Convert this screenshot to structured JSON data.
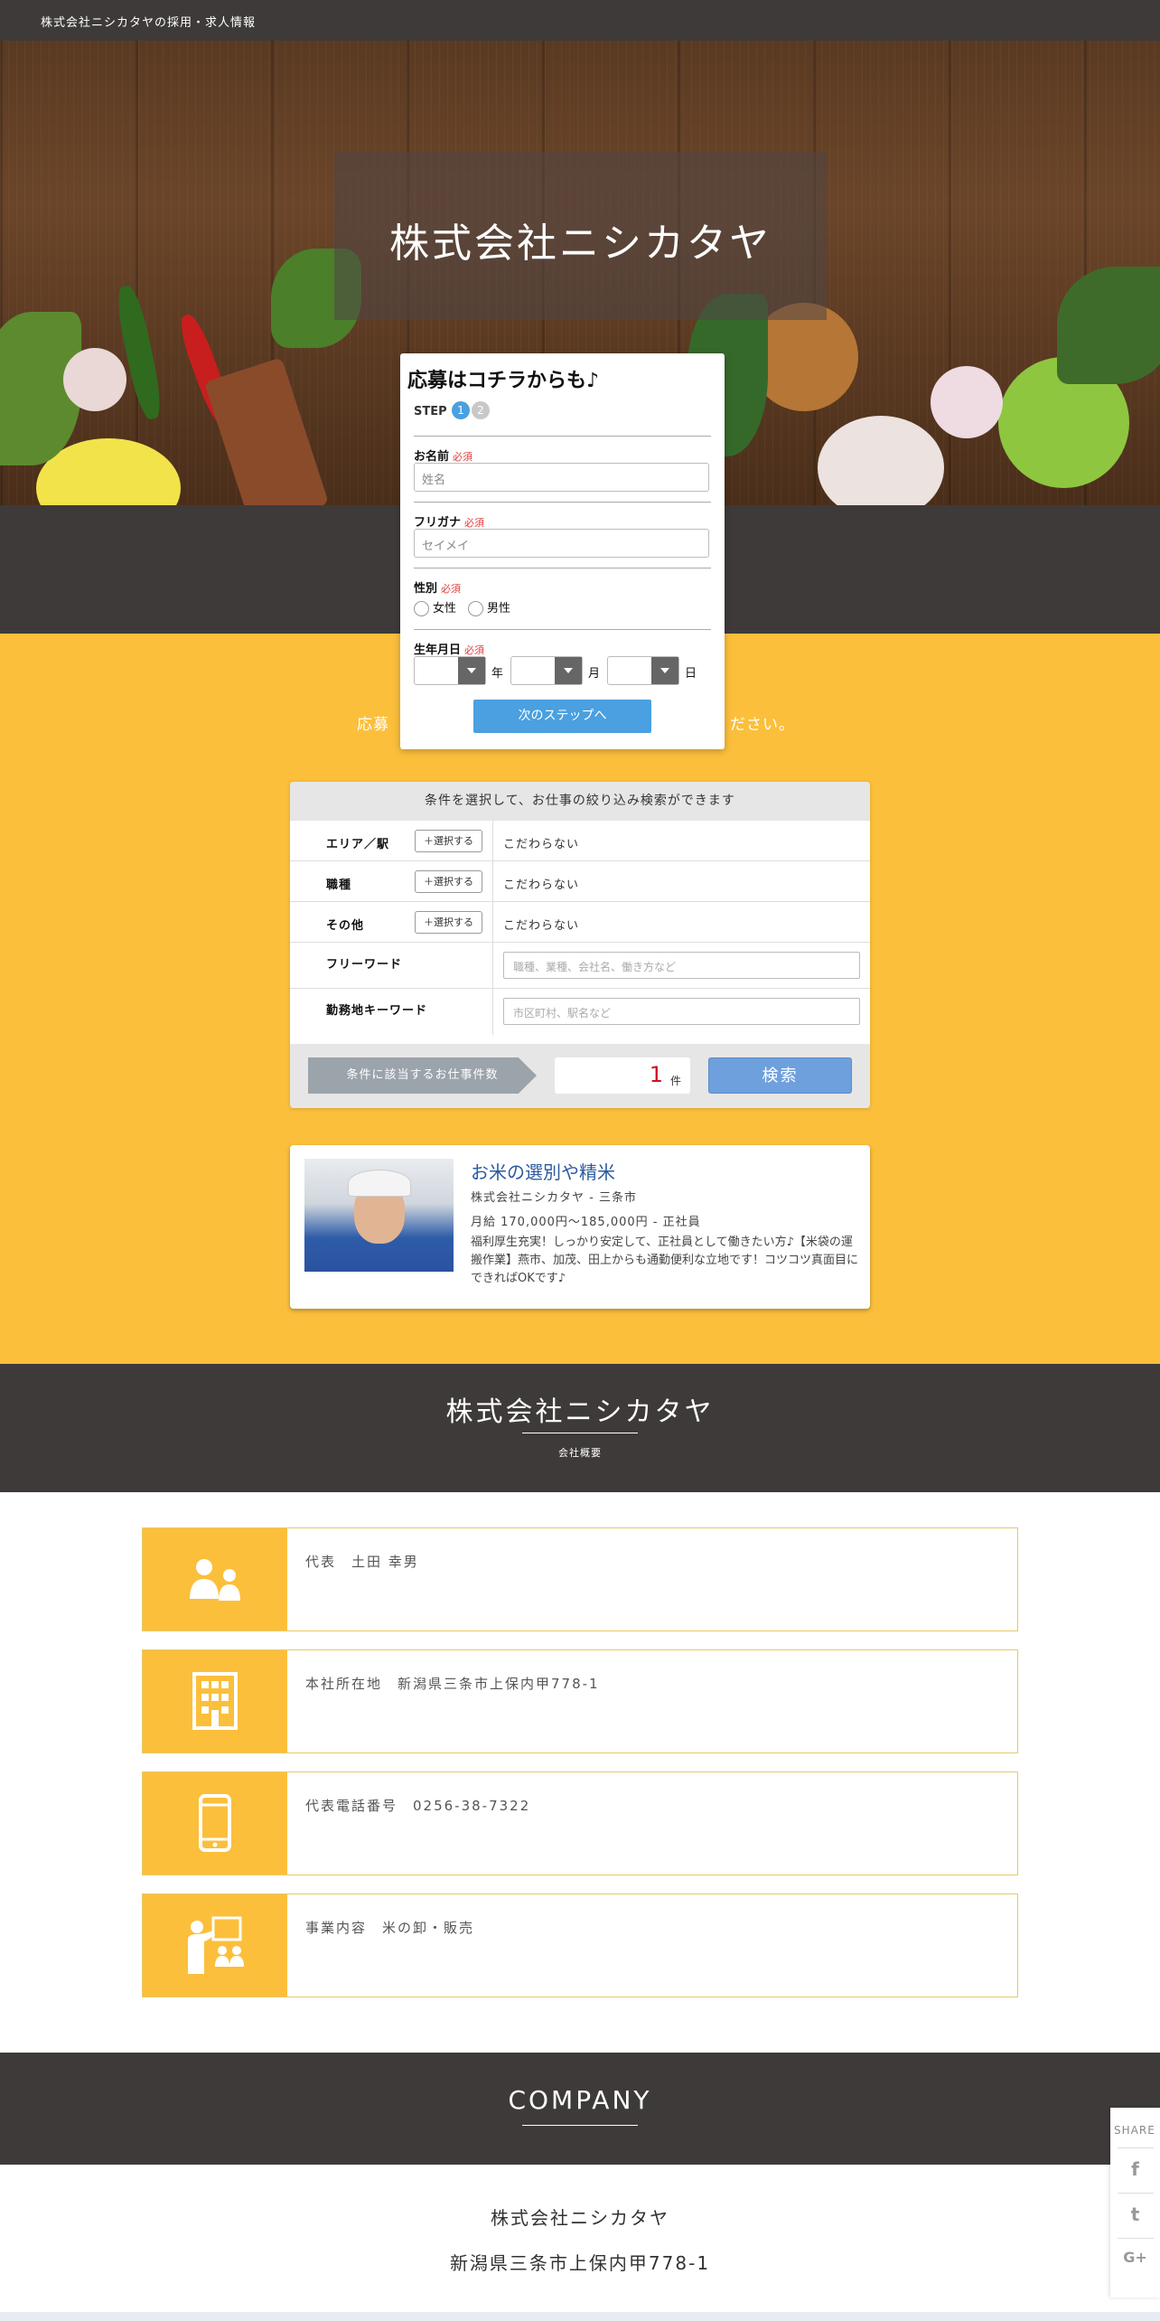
{
  "topbar": {
    "title": "株式会社ニシカタヤの採用・求人情報"
  },
  "hero": {
    "title": "株式会社ニシカタヤ"
  },
  "intro": {
    "line1": "応募",
    "line2": "ださい。"
  },
  "form": {
    "heading": "応募はコチラからも♪",
    "step_label": "STEP",
    "step1": "1",
    "step2": "2",
    "required": "必須",
    "name_label": "お名前",
    "name_placeholder": "姓名",
    "kana_label": "フリガナ",
    "kana_placeholder": "セイメイ",
    "gender_label": "性別",
    "gender_female": "女性",
    "gender_male": "男性",
    "birth_label": "生年月日",
    "year_unit": "年",
    "month_unit": "月",
    "day_unit": "日",
    "next_button": "次のステップへ"
  },
  "search": {
    "header": "条件を選択して、お仕事の絞り込み検索ができます",
    "select_label": "選択する",
    "rows": [
      {
        "label": "エリア／駅",
        "value": "こだわらない"
      },
      {
        "label": "職種",
        "value": "こだわらない"
      },
      {
        "label": "その他",
        "value": "こだわらない"
      }
    ],
    "freeword_label": "フリーワード",
    "freeword_placeholder": "職種、業種、会社名、働き方など",
    "area_keyword_label": "勤務地キーワード",
    "area_keyword_placeholder": "市区町村、駅名など",
    "count_label": "条件に該当するお仕事件数",
    "count": "1",
    "count_unit": "件",
    "search_button": "検索"
  },
  "job": {
    "title": "お米の選別や精米",
    "company": "株式会社ニシカタヤ - 三条市",
    "salary": "月給 170,000円～185,000円 - 正社員",
    "description": "福利厚生充実！しっかり安定して、正社員として働きたい方♪【米袋の運搬作業】燕市、加茂、田上からも通勤便利な立地です！コツコツ真面目にできればOKです♪"
  },
  "company_band": {
    "title": "株式会社ニシカタヤ",
    "subtitle": "会社概要"
  },
  "info": [
    {
      "icon": "people-icon",
      "text": "代表　土田 幸男"
    },
    {
      "icon": "building-icon",
      "text": "本社所在地　新潟県三条市上保内甲778-1"
    },
    {
      "icon": "smartphone-icon",
      "text": "代表電話番号　0256-38-7322"
    },
    {
      "icon": "presentation-icon",
      "text": "事業内容　米の卸・販売"
    }
  ],
  "company_section": {
    "title": "COMPANY",
    "name": "株式会社ニシカタヤ",
    "address": "新潟県三条市上保内甲778-1"
  },
  "share": {
    "label": "SHARE",
    "facebook": "f",
    "twitter": "t",
    "googleplus": "G+"
  },
  "colors": {
    "accent_yellow": "#fbbf3b",
    "dark": "#3e3a39",
    "link_blue": "#2b5aa0",
    "button_blue": "#4aa0e0"
  }
}
